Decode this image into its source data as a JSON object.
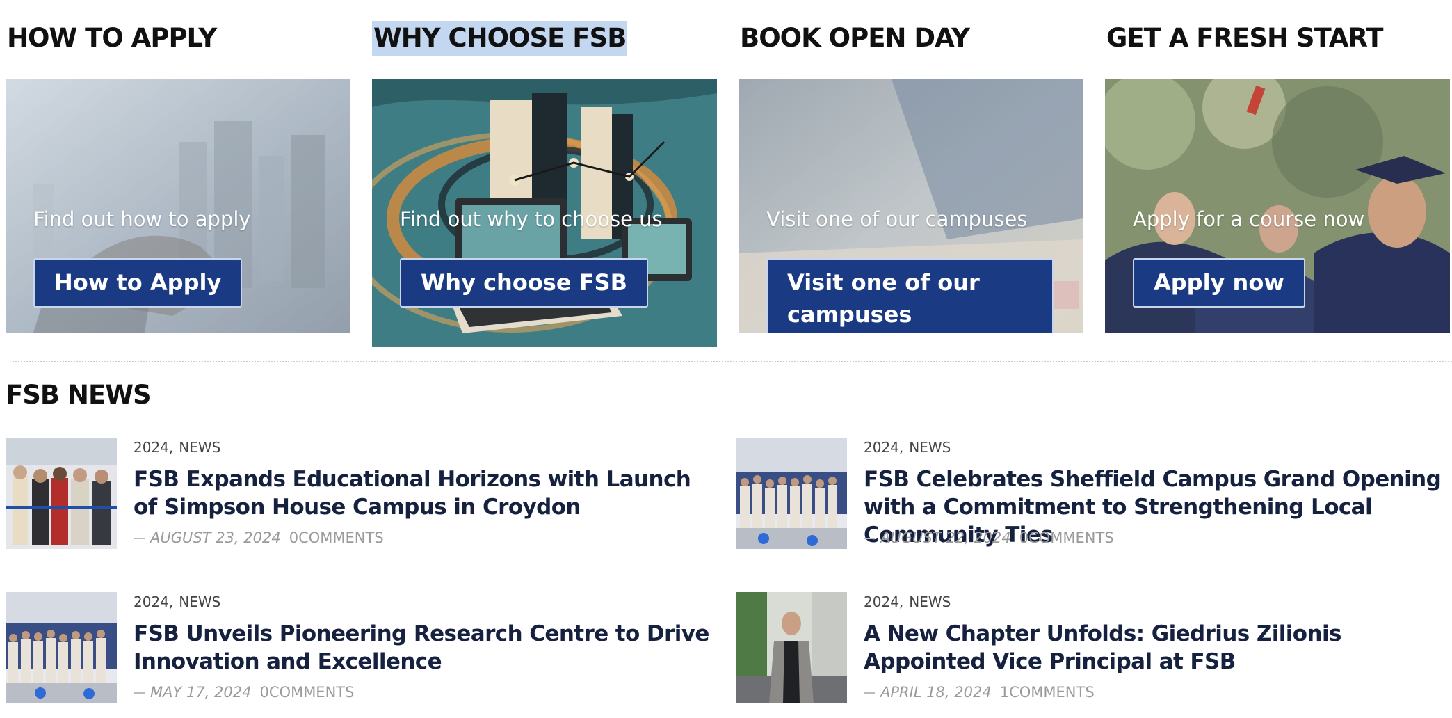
{
  "promos": [
    {
      "heading": "HOW TO APPLY",
      "text": "Find out how to apply",
      "button": "How to Apply",
      "image": "city-handshake-photo",
      "selected": false
    },
    {
      "heading": "WHY CHOOSE FSB",
      "text": "Find out why to choose us",
      "button": "Why choose FSB",
      "image": "computer-art-illustration",
      "selected": true
    },
    {
      "heading": "BOOK OPEN DAY",
      "text": "Visit one of our campuses",
      "button": "Visit one of our campuses",
      "image": "desk-office-photo",
      "selected": false
    },
    {
      "heading": "GET A FRESH START",
      "text": "Apply for a course now",
      "button": "Apply now",
      "image": "graduation-photo",
      "selected": false
    }
  ],
  "news": {
    "heading": "FSB NEWS",
    "items": [
      {
        "year": "2024",
        "category": "NEWS",
        "title": "FSB Expands Educational Horizons with Launch of Simpson House Campus in Croydon",
        "date": "AUGUST 23, 2024",
        "comments": "0COMMENTS",
        "thumb": "ribbon-cutting-photo"
      },
      {
        "year": "2024",
        "category": "NEWS",
        "title": "FSB Celebrates Sheffield Campus Grand Opening with a Commitment to Strengthening Local Community Ties",
        "date": "AUGUST 22, 2024",
        "comments": "0COMMENTS",
        "thumb": "group-photo"
      },
      {
        "year": "2024",
        "category": "NEWS",
        "title": "FSB Unveils Pioneering Research Centre to Drive Innovation and Excellence",
        "date": "MAY 17, 2024",
        "comments": "0COMMENTS",
        "thumb": "group-photo"
      },
      {
        "year": "2024",
        "category": "NEWS",
        "title": "A New Chapter Unfolds: Giedrius Zilionis Appointed Vice Principal at FSB",
        "date": "APRIL 18, 2024",
        "comments": "1COMMENTS",
        "thumb": "portrait-photo"
      }
    ]
  },
  "colors": {
    "button_bg": "#1b3a84",
    "selection_highlight": "#c3d7f1"
  }
}
